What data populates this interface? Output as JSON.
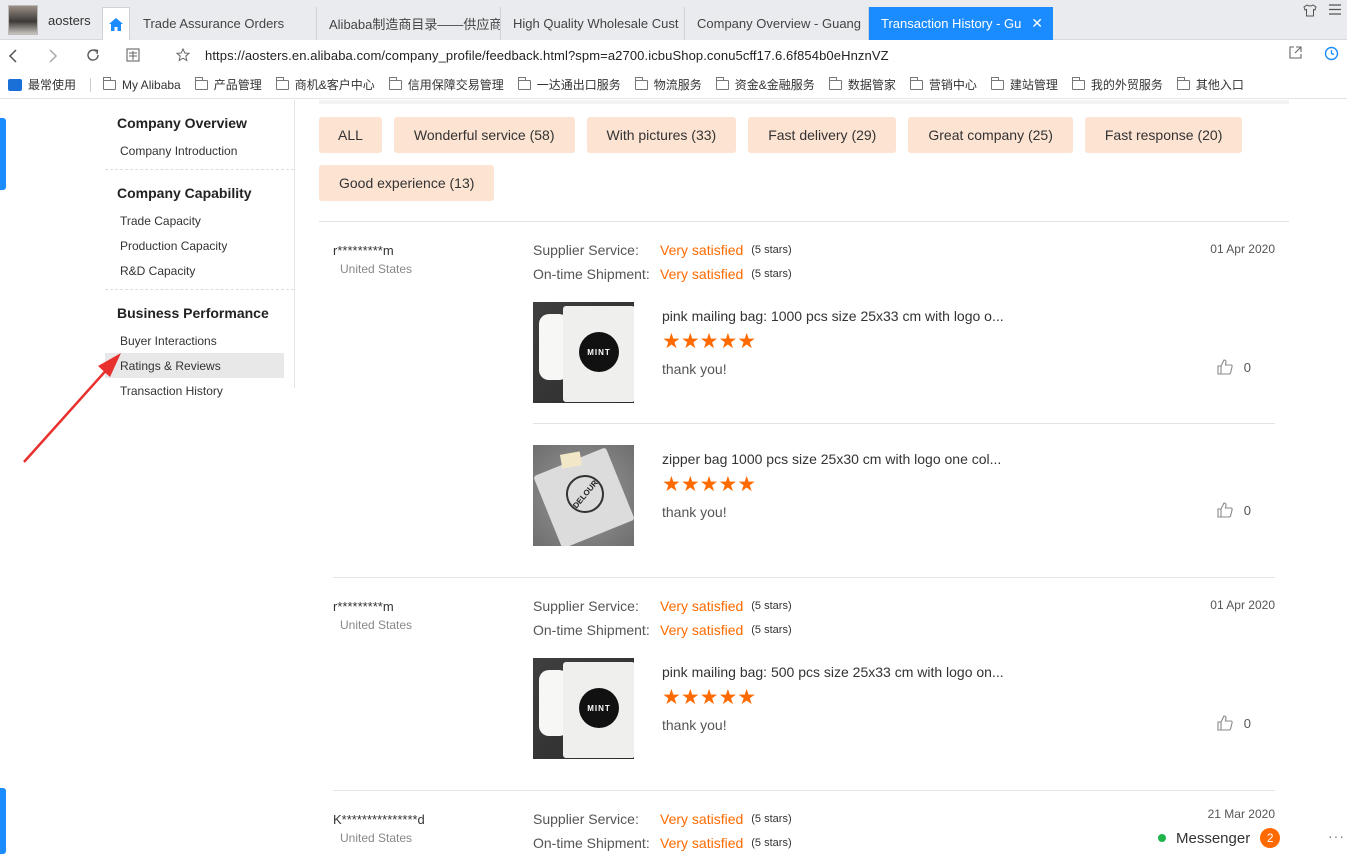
{
  "browser": {
    "profile_name": "aosters",
    "tabs": [
      {
        "label": "Trade Assurance Orders"
      },
      {
        "label": "Alibaba制造商目录——供应商"
      },
      {
        "label": "High Quality Wholesale Cust"
      },
      {
        "label": "Company Overview - Guang"
      },
      {
        "label": "Transaction History - Gu"
      }
    ],
    "tab_close": "✕",
    "url": "https://aosters.en.alibaba.com/company_profile/feedback.html?spm=a2700.icbuShop.conu5cff17.6.6f854b0eHnznVZ",
    "bookmarks": [
      {
        "label": "最常使用"
      },
      {
        "label": "My Alibaba"
      },
      {
        "label": "产品管理"
      },
      {
        "label": "商机&客户中心"
      },
      {
        "label": "信用保障交易管理"
      },
      {
        "label": "一达通出口服务"
      },
      {
        "label": "物流服务"
      },
      {
        "label": "资金&金融服务"
      },
      {
        "label": "数据管家"
      },
      {
        "label": "营销中心"
      },
      {
        "label": "建站管理"
      },
      {
        "label": "我的外贸服务"
      },
      {
        "label": "其他入口"
      }
    ]
  },
  "sidebar": {
    "groups": [
      {
        "title": "Company Overview",
        "items": [
          {
            "label": "Company Introduction"
          }
        ]
      },
      {
        "title": "Company Capability",
        "items": [
          {
            "label": "Trade Capacity"
          },
          {
            "label": "Production Capacity"
          },
          {
            "label": "R&D Capacity"
          }
        ]
      },
      {
        "title": "Business Performance",
        "items": [
          {
            "label": "Buyer Interactions"
          },
          {
            "label": "Ratings & Reviews"
          },
          {
            "label": "Transaction History"
          }
        ]
      }
    ],
    "active_item": "Ratings & Reviews"
  },
  "filters": [
    {
      "label": "ALL"
    },
    {
      "label": "Wonderful service (58)"
    },
    {
      "label": "With pictures (33)"
    },
    {
      "label": "Fast delivery (29)"
    },
    {
      "label": "Great company (25)"
    },
    {
      "label": "Fast response (20)"
    },
    {
      "label": "Good experience (13)"
    }
  ],
  "reviews": [
    {
      "user": "r*********m",
      "country": "United States",
      "date": "01 Apr 2020",
      "ratings": [
        {
          "label": "Supplier Service:",
          "value": "Very satisfied",
          "stars": "(5 stars)"
        },
        {
          "label": "On-time Shipment:",
          "value": "Very satisfied",
          "stars": "(5 stars)"
        }
      ],
      "products": [
        {
          "title": "pink mailing bag: 1000 pcs size 25x33 cm with logo o...",
          "stars": "★★★★★",
          "rating": 5,
          "comment": "thank you!",
          "likes": "0",
          "logo": "MINT"
        },
        {
          "title": "zipper bag 1000 pcs size 25x30 cm with logo one col...",
          "stars": "★★★★★",
          "rating": 5,
          "comment": "thank you!",
          "likes": "0",
          "logo": "DELOUR"
        }
      ]
    },
    {
      "user": "r*********m",
      "country": "United States",
      "date": "01 Apr 2020",
      "ratings": [
        {
          "label": "Supplier Service:",
          "value": "Very satisfied",
          "stars": "(5 stars)"
        },
        {
          "label": "On-time Shipment:",
          "value": "Very satisfied",
          "stars": "(5 stars)"
        }
      ],
      "products": [
        {
          "title": "pink mailing bag: 500 pcs size 25x33 cm with logo on...",
          "stars": "★★★★★",
          "rating": 5,
          "comment": "thank you!",
          "likes": "0",
          "logo": "MINT"
        }
      ]
    },
    {
      "user": "K***************d",
      "country": "United States",
      "date": "21 Mar 2020",
      "ratings": [
        {
          "label": "Supplier Service:",
          "value": "Very satisfied",
          "stars": "(5 stars)"
        },
        {
          "label": "On-time Shipment:",
          "value": "Very satisfied",
          "stars": "(5 stars)"
        }
      ]
    }
  ],
  "messenger": {
    "label": "Messenger",
    "badge": "2",
    "more": "···"
  },
  "colors": {
    "accent": "#1a8cff",
    "orange": "#ff6a00",
    "chip_bg": "#fce3d2",
    "annotation_arrow": "#e8312f"
  }
}
